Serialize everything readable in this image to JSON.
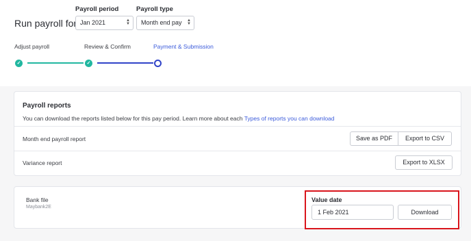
{
  "header": {
    "title": "Run payroll for",
    "payroll_period": {
      "label": "Payroll period",
      "value": "Jan 2021"
    },
    "payroll_type": {
      "label": "Payroll type",
      "value": "Month end pay"
    }
  },
  "stepper": {
    "steps": [
      {
        "label": "Adjust payroll",
        "status": "done"
      },
      {
        "label": "Review & Confirm",
        "status": "done"
      },
      {
        "label": "Payment & Submission",
        "status": "current"
      }
    ]
  },
  "reports": {
    "title": "Payroll reports",
    "description": "You can download the reports listed below for this pay period. Learn more about each ",
    "link_text": "Types of reports you can download",
    "rows": [
      {
        "name": "Month end payroll report",
        "actions": [
          "Save as PDF",
          "Export to CSV"
        ]
      },
      {
        "name": "Variance report",
        "actions": [
          "Export to XLSX"
        ]
      }
    ]
  },
  "bank_file": {
    "title": "Bank file",
    "subtitle": "Maybank2E",
    "value_date_label": "Value date",
    "value_date": "1 Feb 2021",
    "download_label": "Download"
  },
  "colors": {
    "accent": "#3b5bdb",
    "done": "#21b7a0",
    "highlight": "#d9141b"
  }
}
